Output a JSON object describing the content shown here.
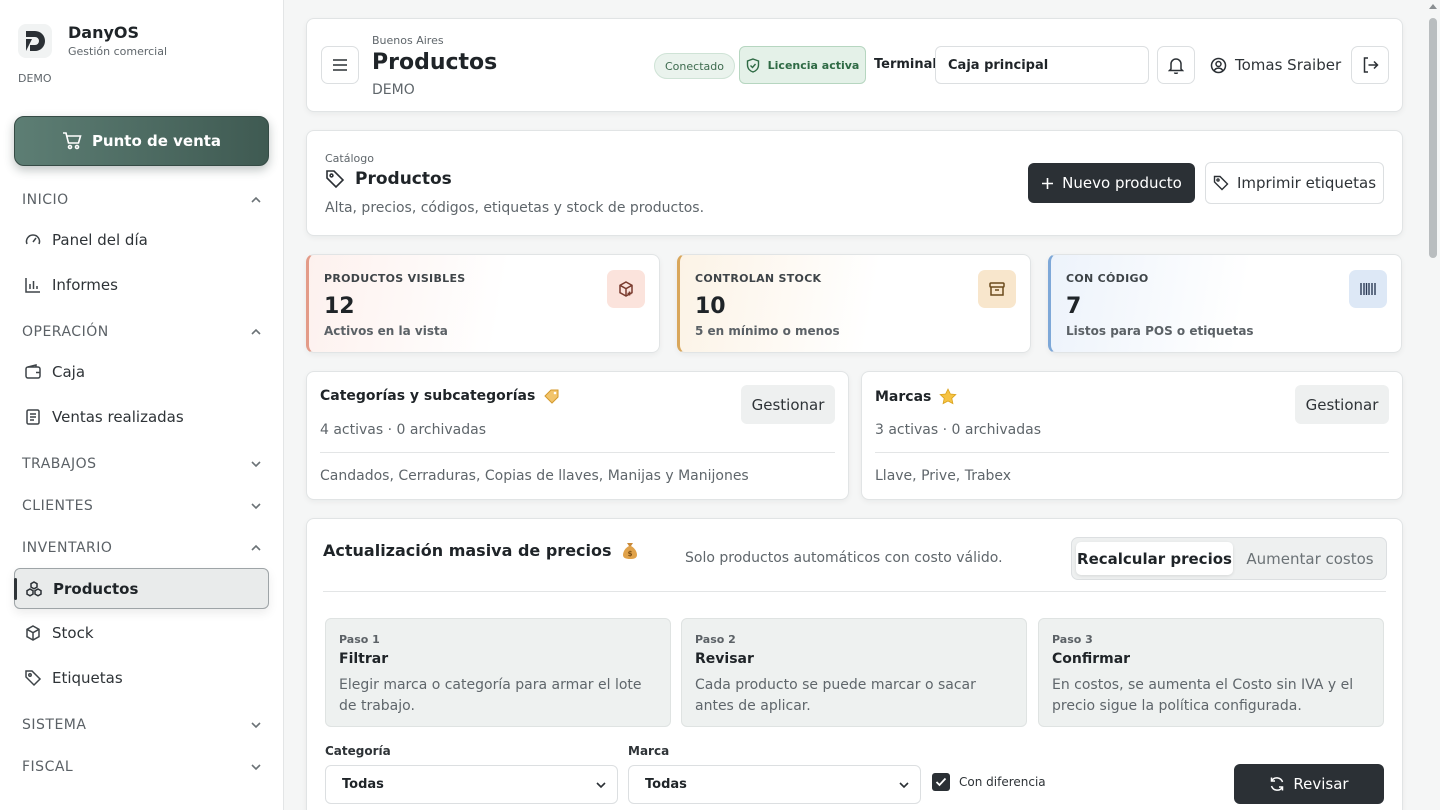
{
  "brand": {
    "name": "DanyOS",
    "subtitle": "Gestión comercial",
    "tag": "DEMO"
  },
  "sidebar": {
    "pos_button": "Punto de venta",
    "sections": [
      {
        "label": "INICIO",
        "expanded": true
      },
      {
        "label": "OPERACIÓN",
        "expanded": true
      },
      {
        "label": "TRABAJOS",
        "expanded": false
      },
      {
        "label": "CLIENTES",
        "expanded": false
      },
      {
        "label": "INVENTARIO",
        "expanded": true
      },
      {
        "label": "SISTEMA",
        "expanded": false
      },
      {
        "label": "FISCAL",
        "expanded": false
      }
    ],
    "items": [
      {
        "label": "Panel del día",
        "icon": "gauge-icon"
      },
      {
        "label": "Informes",
        "icon": "bar-chart-icon"
      },
      {
        "label": "Caja",
        "icon": "wallet-icon"
      },
      {
        "label": "Ventas realizadas",
        "icon": "receipt-icon"
      },
      {
        "label": "Productos",
        "icon": "boxes-icon",
        "active": true
      },
      {
        "label": "Stock",
        "icon": "package-icon"
      },
      {
        "label": "Etiquetas",
        "icon": "tag-icon"
      }
    ]
  },
  "header": {
    "city": "Buenos Aires",
    "title": "Productos",
    "subtitle": "DEMO",
    "status": "Conectado",
    "license": "Licencia activa",
    "terminal_label": "Terminal",
    "terminal_value": "Caja principal",
    "user": "Tomas Sraiber"
  },
  "catalog": {
    "kicker": "Catálogo",
    "title": "Productos",
    "description": "Alta, precios, códigos, etiquetas y stock de productos.",
    "new_button": "Nuevo producto",
    "print_button": "Imprimir etiquetas"
  },
  "stats": [
    {
      "label": "PRODUCTOS VISIBLES",
      "value": "12",
      "sub": "Activos en la vista",
      "icon": "package-plus-icon"
    },
    {
      "label": "CONTROLAN STOCK",
      "value": "10",
      "sub": "5 en mínimo o menos",
      "icon": "archive-icon"
    },
    {
      "label": "CON CÓDIGO",
      "value": "7",
      "sub": "Listos para POS o etiquetas",
      "icon": "barcode-icon"
    }
  ],
  "categories": {
    "title": "Categorías y subcategorías",
    "emoji": "🏷️",
    "count": "4 activas · 0 archivadas",
    "list": "Candados, Cerraduras, Copias de llaves, Manijas y Manijones",
    "button": "Gestionar"
  },
  "brands": {
    "title": "Marcas",
    "emoji": "⭐",
    "count": "3 activas · 0 archivadas",
    "list": "Llave, Prive, Trabex",
    "button": "Gestionar"
  },
  "bulk": {
    "title": "Actualización masiva de precios",
    "emoji": "💰",
    "note": "Solo productos automáticos con costo válido.",
    "tab_active": "Recalcular precios",
    "tab_inactive": "Aumentar costos",
    "steps": [
      {
        "kicker": "Paso 1",
        "title": "Filtrar",
        "desc": "Elegir marca o categoría para armar el lote de trabajo."
      },
      {
        "kicker": "Paso 2",
        "title": "Revisar",
        "desc": "Cada producto se puede marcar o sacar antes de aplicar."
      },
      {
        "kicker": "Paso 3",
        "title": "Confirmar",
        "desc": "En costos, se aumenta el Costo sin IVA y el precio sigue la política configurada."
      }
    ],
    "category_label": "Categoría",
    "category_value": "Todas",
    "brand_label": "Marca",
    "brand_value": "Todas",
    "diff_label": "Con diferencia",
    "diff_checked": true,
    "review_button": "Revisar"
  }
}
